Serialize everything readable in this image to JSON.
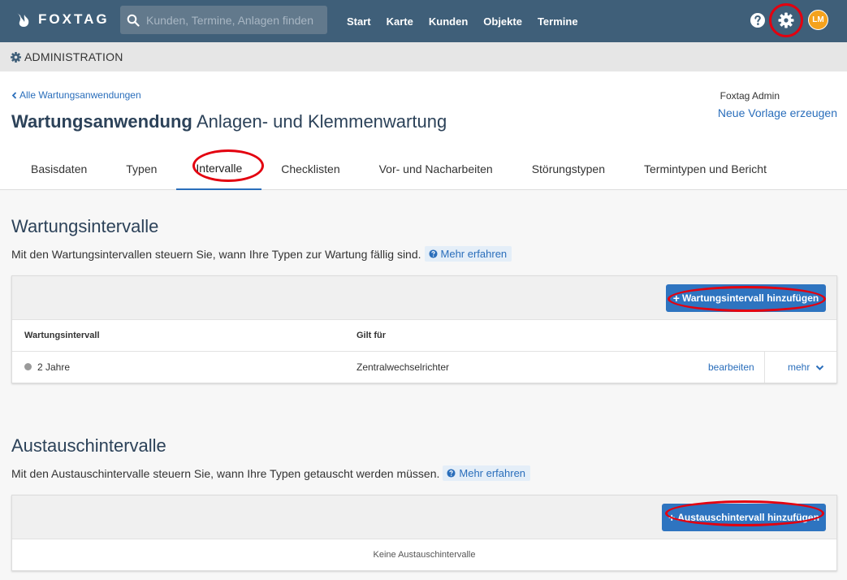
{
  "brand": {
    "name": "FOXTAG"
  },
  "search": {
    "placeholder": "Kunden, Termine, Anlagen finden"
  },
  "nav": {
    "items": [
      "Start",
      "Karte",
      "Kunden",
      "Objekte",
      "Termine"
    ]
  },
  "user": {
    "initials": "LM"
  },
  "admin_bar": {
    "label": "ADMINISTRATION"
  },
  "header": {
    "back_link": "Alle Wartungsanwendungen",
    "title": "Wartungsanwendung",
    "subtitle": "Anlagen- und Klemmenwartung",
    "owner": "Foxtag Admin",
    "new_template": "Neue Vorlage erzeugen"
  },
  "tabs": [
    {
      "label": "Basisdaten"
    },
    {
      "label": "Typen"
    },
    {
      "label": "Intervalle"
    },
    {
      "label": "Checklisten"
    },
    {
      "label": "Vor- und Nacharbeiten"
    },
    {
      "label": "Störungstypen"
    },
    {
      "label": "Termintypen und Bericht"
    }
  ],
  "maintenance": {
    "title": "Wartungsintervalle",
    "description": "Mit den Wartungsintervallen steuern Sie, wann Ihre Typen zur Wartung fällig sind.",
    "more": "Mehr erfahren",
    "add_button": "Wartungsintervall hinzufügen",
    "columns": [
      "Wartungsintervall",
      "Gilt für"
    ],
    "rows": [
      {
        "interval": "2 Jahre",
        "applies_to": "Zentralwechselrichter",
        "edit": "bearbeiten",
        "more": "mehr"
      }
    ]
  },
  "exchange": {
    "title": "Austauschintervalle",
    "description": "Mit den Austauschintervalle steuern Sie, wann Ihre Typen getauscht werden müssen.",
    "more": "Mehr erfahren",
    "add_button": "Austauschintervall hinzufügen",
    "empty": "Keine Austauschintervalle"
  },
  "colors": {
    "nav_bg": "#3f5f79",
    "accent": "#2e74c0",
    "highlight": "#e3000f",
    "avatar": "#f4a21d"
  }
}
